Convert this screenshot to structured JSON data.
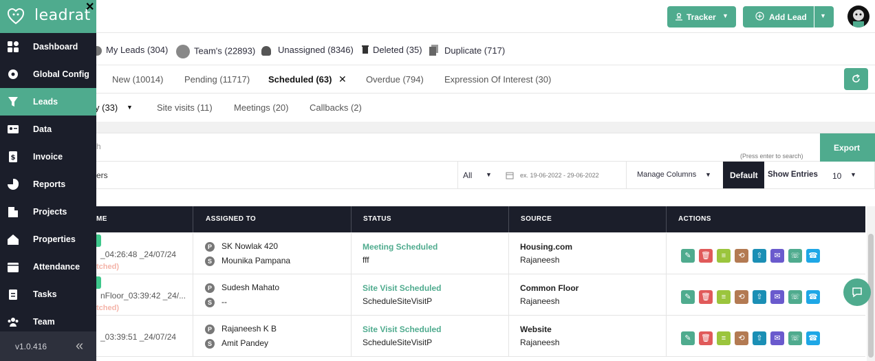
{
  "app": {
    "brand": "leadrat",
    "version": "v1.0.416"
  },
  "sidebar": {
    "items": [
      {
        "label": "Dashboard",
        "icon": "dashboard-icon"
      },
      {
        "label": "Global Config",
        "icon": "gear-icon"
      },
      {
        "label": "Leads",
        "icon": "funnel-icon",
        "active": true
      },
      {
        "label": "Data",
        "icon": "id-card-icon"
      },
      {
        "label": "Invoice",
        "icon": "invoice-icon"
      },
      {
        "label": "Reports",
        "icon": "pie-chart-icon"
      },
      {
        "label": "Projects",
        "icon": "building-icon"
      },
      {
        "label": "Properties",
        "icon": "house-icon"
      },
      {
        "label": "Attendance",
        "icon": "calendar-icon"
      },
      {
        "label": "Tasks",
        "icon": "clipboard-icon"
      },
      {
        "label": "Team",
        "icon": "team-icon"
      }
    ],
    "collapse_glyph": "«"
  },
  "topbar": {
    "tracker_label": "Tracker",
    "add_lead_label": "Add Lead"
  },
  "lead_scope": [
    {
      "label": "My Leads (304)"
    },
    {
      "label": "Team's (22893)"
    },
    {
      "label": "Unassigned (8346)"
    },
    {
      "label": "Deleted (35)"
    },
    {
      "label": "Duplicate (717)"
    }
  ],
  "status_tabs": [
    {
      "label": "New (10014)"
    },
    {
      "label": "Pending (11717)"
    },
    {
      "label": "Scheduled (63)",
      "active": true
    },
    {
      "label": "Overdue (794)"
    },
    {
      "label": "Expression Of Interest (30)"
    }
  ],
  "sub_tabs": [
    {
      "label": "y (33)"
    },
    {
      "label": "Site visits (11)"
    },
    {
      "label": "Meetings (20)"
    },
    {
      "label": "Callbacks (2)"
    }
  ],
  "search": {
    "placeholder_visible": "h",
    "hint": "(Press enter to search)",
    "export_label": "Export"
  },
  "filters": {
    "filters_label": "ers",
    "all_label": "All",
    "date_placeholder": "ex. 19-06-2022 - 29-06-2022",
    "manage_columns": "Manage Columns",
    "default_label": "Default",
    "show_entries_label": "Show Entries",
    "entries_value": "10"
  },
  "table": {
    "headers": [
      "me",
      "Assigned To",
      "Status",
      "Source",
      "Actions"
    ],
    "rows": [
      {
        "name_line": "_04:26:48 _24/07/24",
        "sub": "tched)",
        "assigned_p": "SK Nowlak 420",
        "assigned_s": "Mounika Pampana",
        "status": "Meeting Scheduled",
        "status_note": "fff",
        "source": "Housing.com",
        "source_sub": "Rajaneesh"
      },
      {
        "name_line": "nFloor_03:39:42 _24/...",
        "sub": "tched)",
        "assigned_p": "Sudesh Mahato",
        "assigned_s": "--",
        "status": "Site Visit Scheduled",
        "status_note": "ScheduleSiteVisitP",
        "source": "Common Floor",
        "source_sub": "Rajaneesh"
      },
      {
        "name_line": "_03:39:51 _24/07/24",
        "sub": "",
        "assigned_p": "Rajaneesh K B",
        "assigned_s": "Amit Pandey",
        "status": "Site Visit Scheduled",
        "status_note": "ScheduleSiteVisitP",
        "source": "Website",
        "source_sub": "Rajaneesh"
      }
    ],
    "badge_p": "P",
    "badge_s": "S"
  },
  "colors": {
    "accent": "#4fab8e",
    "sidebar_bg": "#1b1e2a",
    "header_bg": "#1b1e2a",
    "status_text": "#4fab8e"
  }
}
